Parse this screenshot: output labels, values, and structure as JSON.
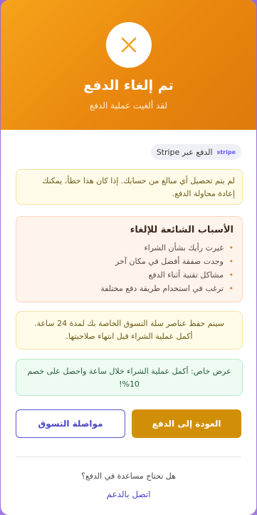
{
  "header": {
    "title": "تم إلغاء الدفع",
    "subtitle": "لقد ألغيت عملية الدفع",
    "icon": "close-icon"
  },
  "payment_provider": {
    "label": "الدفع عبر Stripe",
    "logo_text": "stripe"
  },
  "warning": {
    "text": "لم يتم تحصيل أي مبالغ من حسابك. إذا كان هذا خطأ، يمكنك إعادة محاولة الدفع."
  },
  "reasons": {
    "title": "الأسباب الشائعة للإلغاء",
    "items": [
      "غيرت رأيك بشأن الشراء",
      "وجدت صفقة أفضل في مكان آخر",
      "مشاكل تقنية أثناء الدفع",
      "ترغب في استخدام طريقة دفع مختلفة"
    ]
  },
  "info": {
    "text": "سيتم حفظ عناصر سلة التسوق الخاصة بك لمدة 24 ساعة. أكمل عملية الشراء قبل انتهاء صلاحيتها."
  },
  "offer": {
    "text": "عرض خاص: أكمل عملية الشراء خلال ساعة واحصل على خصم 10%!"
  },
  "actions": {
    "return_label": "العودة إلى الدفع",
    "continue_label": "مواصلة التسوق"
  },
  "help": {
    "question": "هل تحتاج مساعدة في الدفع؟",
    "link": "اتصل بالدعم"
  },
  "colors": {
    "header_gradient_start": "#f6a31a",
    "header_gradient_end": "#dd7a0c",
    "primary_button": "#d18f08",
    "accent": "#4a44c9"
  }
}
